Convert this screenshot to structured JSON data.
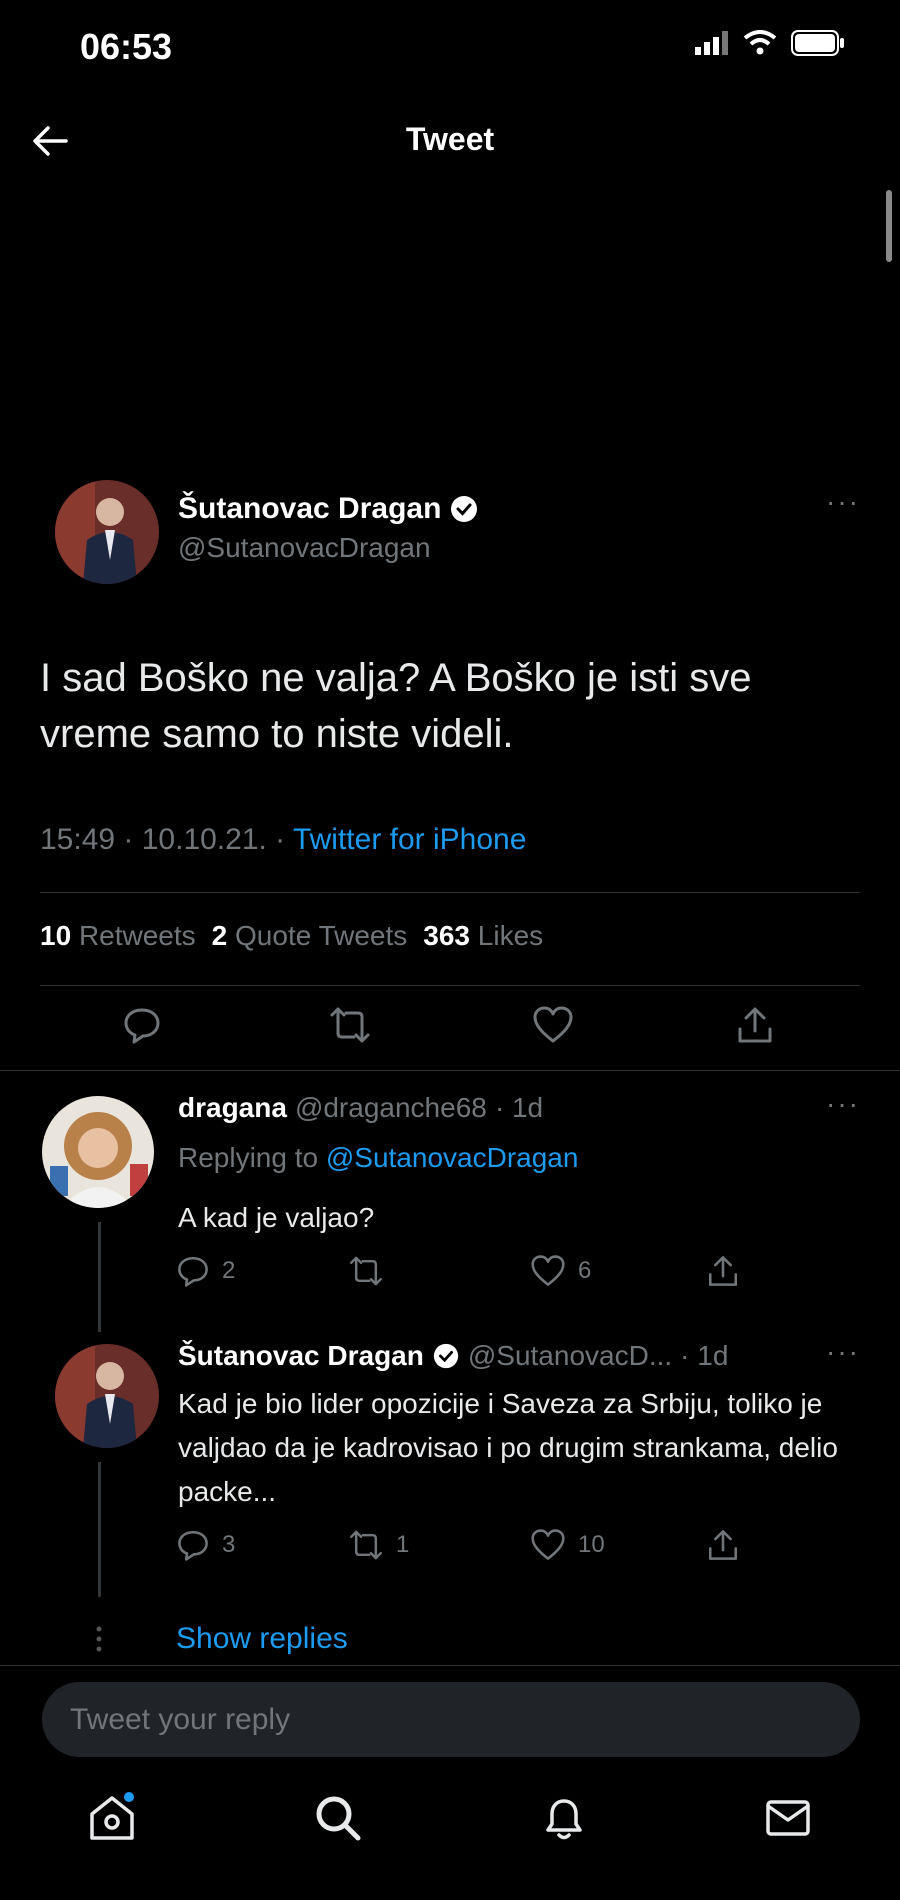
{
  "status_bar": {
    "time": "06:53"
  },
  "header": {
    "title": "Tweet"
  },
  "main_tweet": {
    "author_name": "Šutanovac Dragan",
    "handle": "@SutanovacDragan",
    "text": "I sad Boško ne valja? A Boško je isti sve vreme samo to niste videli.",
    "time": "15:49 · 10.10.21. · ",
    "source": "Twitter for iPhone",
    "retweets_count": "10",
    "retweets_label": "Retweets",
    "quotes_count": "2",
    "quotes_label": "Quote Tweets",
    "likes_count": "363",
    "likes_label": "Likes"
  },
  "replies": [
    {
      "name": "dragana",
      "handle": "@draganche68",
      "age": "· 1d",
      "replying_prefix": "Replying to ",
      "replying_to": "@SutanovacDragan",
      "text": "A kad je valjao?",
      "reply_count": "2",
      "retweet_count": "",
      "like_count": "6"
    },
    {
      "name": "Šutanovac Dragan",
      "handle": "@SutanovacD...",
      "age": "· 1d",
      "text": "Kad je bio lider opozicije i Saveza za Srbiju, toliko je valjdao da je kadrovisao i po drugim strankama, delio packe...",
      "reply_count": "3",
      "retweet_count": "1",
      "like_count": "10"
    }
  ],
  "show_replies_label": "Show replies",
  "reply_input": {
    "placeholder": "Tweet your reply"
  },
  "icons": {
    "back": "arrow-left-icon",
    "verified": "verified-badge-icon",
    "more": "more-horizontal-icon",
    "reply": "reply-icon",
    "retweet": "retweet-icon",
    "like": "heart-icon",
    "share": "share-icon",
    "home": "home-icon",
    "search": "search-icon",
    "notifications": "bell-icon",
    "messages": "mail-icon"
  },
  "colors": {
    "accent": "#1d9bf0",
    "background": "#000000",
    "muted": "#71767b"
  }
}
